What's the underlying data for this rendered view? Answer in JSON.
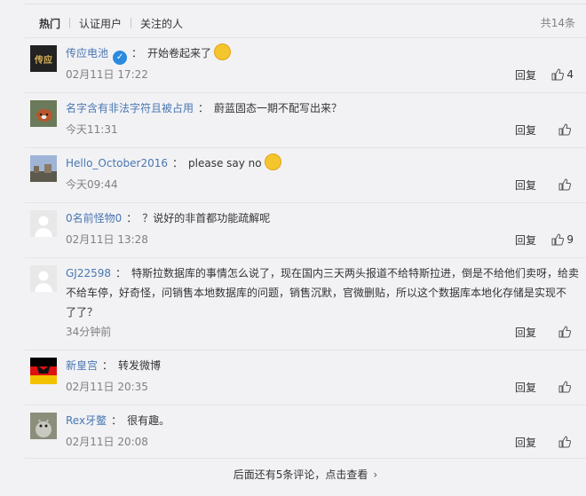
{
  "tabs": [
    {
      "label": "热门"
    },
    {
      "label": "认证用户"
    },
    {
      "label": "关注的人"
    }
  ],
  "total_count": "共14条",
  "comments": [
    {
      "user": "传应电池",
      "text": "开始卷起来了",
      "time": "02月11日 17:22",
      "reply": "回复",
      "likes": "4",
      "avatar_text": "传应"
    },
    {
      "user": "名字含有非法字符且被占用",
      "text": "蔚蓝固态一期不配写出来？",
      "time": "今天11:31",
      "reply": "回复",
      "likes": ""
    },
    {
      "user": "Hello_October2016",
      "text": "please say no",
      "time": "今天09:44",
      "reply": "回复",
      "likes": ""
    },
    {
      "user": "0名前怪物0",
      "text": "？说好的非首都功能疏解呢",
      "time": "02月11日 13:28",
      "reply": "回复",
      "likes": "9"
    },
    {
      "user": "GJ22598",
      "text_line1": "特斯拉数据库的事情怎么说了，现在国内三天两头报道不给特斯拉进，倒是不给他们卖呀，给卖",
      "text_line2": "不给车停，好奇怪，问销售本地数据库的问题，销售沉默，官微删贴，所以这个数据库本地化存储是实现不",
      "text_line3": "了了？",
      "time": "34分钟前",
      "reply": "回复",
      "likes": ""
    },
    {
      "user": "新皇宫",
      "text": "转发微博",
      "time": "02月11日 20:35",
      "reply": "回复",
      "likes": ""
    },
    {
      "user": "Rex牙鳖",
      "text": "很有趣。",
      "time": "02月11日 20:08",
      "reply": "回复",
      "likes": ""
    }
  ],
  "more_text": "后面还有5条评论，点击查看",
  "colors": {
    "link": "#4a77b0",
    "meta": "#808080",
    "bg": "#f2f2f5"
  },
  "icons": {
    "like": "thumbs-up-icon",
    "verified": "verified-badge-icon",
    "more": "chevron-right-icon"
  }
}
